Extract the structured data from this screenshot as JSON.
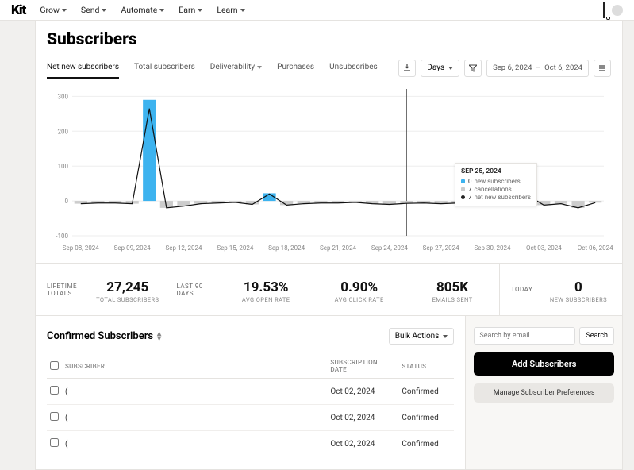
{
  "brand": "Kit",
  "nav": [
    "Grow",
    "Send",
    "Automate",
    "Earn",
    "Learn"
  ],
  "page_title": "Subscribers",
  "tabs": [
    {
      "label": "Net new subscribers",
      "active": true
    },
    {
      "label": "Total subscribers"
    },
    {
      "label": "Deliverability",
      "caret": true
    },
    {
      "label": "Purchases"
    },
    {
      "label": "Unsubscribes"
    }
  ],
  "date_range": {
    "label": "Days",
    "from": "Sep 6, 2024",
    "to": "Oct 6, 2024",
    "sep": "–"
  },
  "tooltip": {
    "date": "SEP 25, 2024",
    "rows": [
      {
        "color": "#3db3ef",
        "num": "0",
        "label": "new subscribers"
      },
      {
        "color": "#ccc",
        "num": "7",
        "label": "cancellations"
      },
      {
        "dot": true,
        "num": "7",
        "label": "net new subscribers"
      }
    ]
  },
  "stats": {
    "lifetime_label": "LIFETIME TOTALS",
    "lifetime": {
      "value": "27,245",
      "sub": "TOTAL SUBSCRIBERS"
    },
    "last90_label": "LAST 90 DAYS",
    "open": {
      "value": "19.53%",
      "sub": "AVG OPEN RATE"
    },
    "click": {
      "value": "0.90%",
      "sub": "AVG CLICK RATE"
    },
    "sent": {
      "value": "805K",
      "sub": "EMAILS SENT"
    },
    "today_label": "TODAY",
    "today": {
      "value": "0",
      "sub": "NEW SUBSCRIBERS"
    }
  },
  "confirmed": {
    "title": "Confirmed Subscribers",
    "bulk": "Bulk Actions",
    "columns": {
      "subscriber": "SUBSCRIBER",
      "date": "SUBSCRIPTION DATE",
      "status": "STATUS"
    },
    "rows": [
      {
        "name": "(",
        "date": "Oct 02, 2024",
        "status": "Confirmed"
      },
      {
        "name": "(",
        "date": "Oct 02, 2024",
        "status": "Confirmed"
      },
      {
        "name": "(",
        "date": "Oct 02, 2024",
        "status": "Confirmed"
      }
    ]
  },
  "sidebar": {
    "search_placeholder": "Search by email",
    "search_btn": "Search",
    "add_btn": "Add Subscribers",
    "prefs_btn": "Manage Subscriber Preferences"
  },
  "chart_data": {
    "type": "bar+line",
    "x_ticks": [
      "Sep 08, 2024",
      "Sep 09, 2024",
      "Sep 12, 2024",
      "Sep 15, 2024",
      "Sep 18, 2024",
      "Sep 21, 2024",
      "Sep 24, 2024",
      "Sep 27, 2024",
      "Sep 30, 2024",
      "Oct 03, 2024",
      "Oct 06, 2024"
    ],
    "y_ticks": [
      -100,
      0,
      100,
      200,
      300
    ],
    "ylim": [
      -100,
      310
    ],
    "series": [
      {
        "name": "new subscribers",
        "type": "bar",
        "color": "#3db3ef",
        "data": [
          {
            "x": "Sep 06",
            "v": 0
          },
          {
            "x": "Sep 07",
            "v": 0
          },
          {
            "x": "Sep 08",
            "v": 0
          },
          {
            "x": "Sep 09",
            "v": 0
          },
          {
            "x": "Sep 10",
            "v": 290
          },
          {
            "x": "Sep 11",
            "v": 0
          },
          {
            "x": "Sep 12",
            "v": 0
          },
          {
            "x": "Sep 13",
            "v": 0
          },
          {
            "x": "Sep 14",
            "v": 0
          },
          {
            "x": "Sep 15",
            "v": 0
          },
          {
            "x": "Sep 16",
            "v": 0
          },
          {
            "x": "Sep 17",
            "v": 22
          },
          {
            "x": "Sep 18",
            "v": 0
          },
          {
            "x": "Sep 19",
            "v": 0
          },
          {
            "x": "Sep 20",
            "v": 0
          },
          {
            "x": "Sep 21",
            "v": 0
          },
          {
            "x": "Sep 22",
            "v": 0
          },
          {
            "x": "Sep 23",
            "v": 0
          },
          {
            "x": "Sep 24",
            "v": 0
          },
          {
            "x": "Sep 25",
            "v": 0
          },
          {
            "x": "Sep 26",
            "v": 0
          },
          {
            "x": "Sep 27",
            "v": 0
          },
          {
            "x": "Sep 28",
            "v": 0
          },
          {
            "x": "Sep 29",
            "v": 0
          },
          {
            "x": "Sep 30",
            "v": 0
          },
          {
            "x": "Oct 01",
            "v": 0
          },
          {
            "x": "Oct 02",
            "v": 20
          },
          {
            "x": "Oct 03",
            "v": 0
          },
          {
            "x": "Oct 04",
            "v": 0
          },
          {
            "x": "Oct 05",
            "v": 0
          },
          {
            "x": "Oct 06",
            "v": 0
          }
        ]
      },
      {
        "name": "cancellations",
        "type": "bar_neg",
        "color": "#ccc",
        "data": [
          {
            "x": "Sep 06",
            "v": 8
          },
          {
            "x": "Sep 07",
            "v": 6
          },
          {
            "x": "Sep 08",
            "v": 6
          },
          {
            "x": "Sep 09",
            "v": 8
          },
          {
            "x": "Sep 10",
            "v": 0
          },
          {
            "x": "Sep 11",
            "v": 20
          },
          {
            "x": "Sep 12",
            "v": 15
          },
          {
            "x": "Sep 13",
            "v": 8
          },
          {
            "x": "Sep 14",
            "v": 6
          },
          {
            "x": "Sep 15",
            "v": 4
          },
          {
            "x": "Sep 16",
            "v": 10
          },
          {
            "x": "Sep 17",
            "v": 0
          },
          {
            "x": "Sep 18",
            "v": 12
          },
          {
            "x": "Sep 19",
            "v": 8
          },
          {
            "x": "Sep 20",
            "v": 6
          },
          {
            "x": "Sep 21",
            "v": 6
          },
          {
            "x": "Sep 22",
            "v": 4
          },
          {
            "x": "Sep 23",
            "v": 8
          },
          {
            "x": "Sep 24",
            "v": 10
          },
          {
            "x": "Sep 25",
            "v": 7
          },
          {
            "x": "Sep 26",
            "v": 6
          },
          {
            "x": "Sep 27",
            "v": 8
          },
          {
            "x": "Sep 28",
            "v": 6
          },
          {
            "x": "Sep 29",
            "v": 5
          },
          {
            "x": "Sep 30",
            "v": 10
          },
          {
            "x": "Oct 01",
            "v": 6
          },
          {
            "x": "Oct 02",
            "v": 0
          },
          {
            "x": "Oct 03",
            "v": 12
          },
          {
            "x": "Oct 04",
            "v": 8
          },
          {
            "x": "Oct 05",
            "v": 20
          },
          {
            "x": "Oct 06",
            "v": 5
          }
        ]
      },
      {
        "name": "net new subscribers",
        "type": "line",
        "color": "#111",
        "data": [
          {
            "x": "Sep 06",
            "v": -8
          },
          {
            "x": "Sep 07",
            "v": -6
          },
          {
            "x": "Sep 08",
            "v": -6
          },
          {
            "x": "Sep 09",
            "v": -8
          },
          {
            "x": "Sep 10",
            "v": 265
          },
          {
            "x": "Sep 11",
            "v": -20
          },
          {
            "x": "Sep 12",
            "v": -15
          },
          {
            "x": "Sep 13",
            "v": -8
          },
          {
            "x": "Sep 14",
            "v": -6
          },
          {
            "x": "Sep 15",
            "v": -4
          },
          {
            "x": "Sep 16",
            "v": -10
          },
          {
            "x": "Sep 17",
            "v": 20
          },
          {
            "x": "Sep 18",
            "v": -12
          },
          {
            "x": "Sep 19",
            "v": -8
          },
          {
            "x": "Sep 20",
            "v": -6
          },
          {
            "x": "Sep 21",
            "v": -6
          },
          {
            "x": "Sep 22",
            "v": -4
          },
          {
            "x": "Sep 23",
            "v": -8
          },
          {
            "x": "Sep 24",
            "v": -10
          },
          {
            "x": "Sep 25",
            "v": -7
          },
          {
            "x": "Sep 26",
            "v": -6
          },
          {
            "x": "Sep 27",
            "v": -8
          },
          {
            "x": "Sep 28",
            "v": -6
          },
          {
            "x": "Sep 29",
            "v": -5
          },
          {
            "x": "Sep 30",
            "v": -10
          },
          {
            "x": "Oct 01",
            "v": -6
          },
          {
            "x": "Oct 02",
            "v": 18
          },
          {
            "x": "Oct 03",
            "v": -12
          },
          {
            "x": "Oct 04",
            "v": -8
          },
          {
            "x": "Oct 05",
            "v": -20
          },
          {
            "x": "Oct 06",
            "v": -5
          }
        ]
      }
    ]
  }
}
